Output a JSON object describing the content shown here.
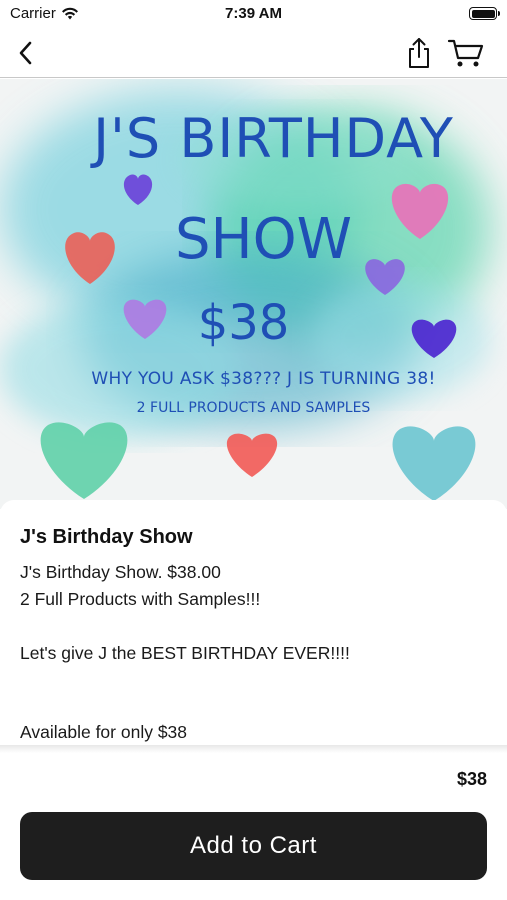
{
  "status": {
    "carrier": "Carrier",
    "time": "7:39 AM"
  },
  "nav": {
    "back_icon": "chevron-left-icon",
    "share_icon": "share-icon",
    "cart_icon": "cart-icon"
  },
  "hero": {
    "title_line1": "J'S BIRTHDAY",
    "title_line2": "SHOW",
    "price": "$38",
    "tagline": "WHY YOU ASK $38??? J IS TURNING 38!",
    "subline": "2 FULL PRODUCTS AND SAMPLES"
  },
  "product": {
    "title": "J's Birthday Show",
    "desc_line1": "J's Birthday Show. $38.00",
    "desc_line2": "2 Full Products with Samples!!!",
    "desc_line3": "Let's give J the BEST BIRTHDAY EVER!!!!",
    "desc_line4": "Available for only $38"
  },
  "footer": {
    "price": "$38",
    "add_to_cart_label": "Add to Cart"
  },
  "colors": {
    "accent_text": "#1f4fb5",
    "button_bg": "#1e1e1e"
  }
}
